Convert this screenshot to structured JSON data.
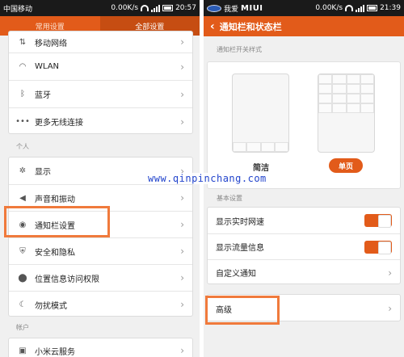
{
  "left_screen": {
    "statusbar": {
      "carrier": "中国移动",
      "speed": "0.00K/s",
      "time": "20:57"
    },
    "tabs": [
      {
        "label": "常用设置"
      },
      {
        "label": "全部设置"
      }
    ],
    "group1": [
      {
        "label": "移动网络"
      },
      {
        "label": "WLAN"
      },
      {
        "label": "蓝牙"
      },
      {
        "label": "更多无线连接"
      }
    ],
    "section_personal": "个人",
    "group2": [
      {
        "label": "显示"
      },
      {
        "label": "声音和振动"
      },
      {
        "label": "通知栏设置"
      },
      {
        "label": "安全和隐私"
      },
      {
        "label": "位置信息访问权限"
      },
      {
        "label": "勿扰模式"
      }
    ],
    "section_account": "帐户",
    "group3": [
      {
        "label": "小米云服务"
      }
    ]
  },
  "right_screen": {
    "statusbar": {
      "prefix": "我爱",
      "logo": "MIUI",
      "speed": "0.00K/s",
      "time": "21:39"
    },
    "title": "通知栏和状态栏",
    "section_style": "通知栏开关样式",
    "style_simple": "简洁",
    "style_single": "单页",
    "section_basic": "基本设置",
    "basic_rows": [
      {
        "label": "显示实时网速"
      },
      {
        "label": "显示流量信息"
      },
      {
        "label": "自定义通知"
      }
    ],
    "advanced": "高级"
  },
  "watermark": "www.qinpinchang.com",
  "colors": {
    "accent": "#e25b1a",
    "highlight": "#f07a3c",
    "watermark": "#2244cc"
  }
}
